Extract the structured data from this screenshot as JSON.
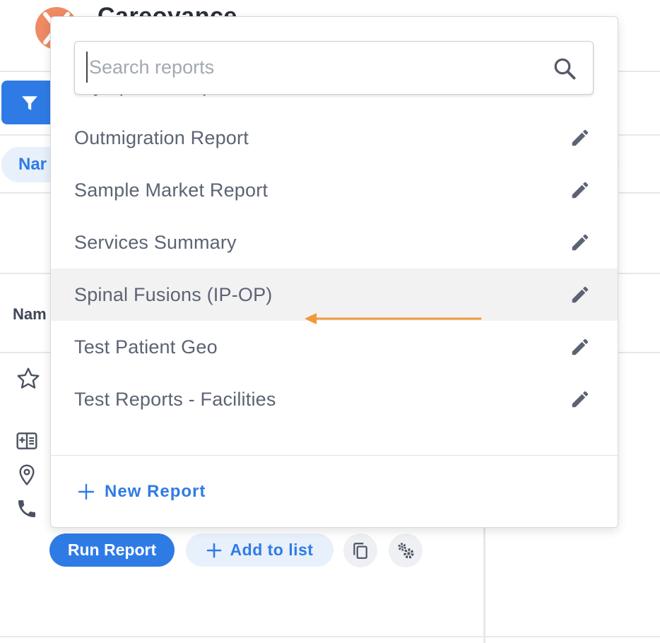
{
  "app": {
    "brand_name": "Careoyance"
  },
  "background": {
    "name_chip_label": "Nar",
    "column_header": "Nam",
    "run_report_label": "Run Report",
    "add_to_list_label": "Add to list"
  },
  "dropdown": {
    "search_placeholder": "Search reports",
    "items": [
      {
        "label": "Olympus - Hospital Review",
        "highlighted": false
      },
      {
        "label": "Outmigration Report",
        "highlighted": false
      },
      {
        "label": "Sample Market Report",
        "highlighted": false
      },
      {
        "label": "Services Summary",
        "highlighted": false
      },
      {
        "label": "Spinal Fusions (IP-OP)",
        "highlighted": true
      },
      {
        "label": "Test Patient Geo",
        "highlighted": false
      },
      {
        "label": "Test Reports - Facilities",
        "highlighted": false
      }
    ],
    "new_report_label": "New Report"
  },
  "colors": {
    "primary": "#2f7be5",
    "annotation_arrow": "#f0993a",
    "logo": "#ee8a64"
  },
  "icons": {
    "search": "search-icon",
    "edit": "pencil-icon",
    "add": "plus-icon",
    "filter": "filter-icon",
    "copy": "copy-icon",
    "settings": "gears-icon"
  }
}
